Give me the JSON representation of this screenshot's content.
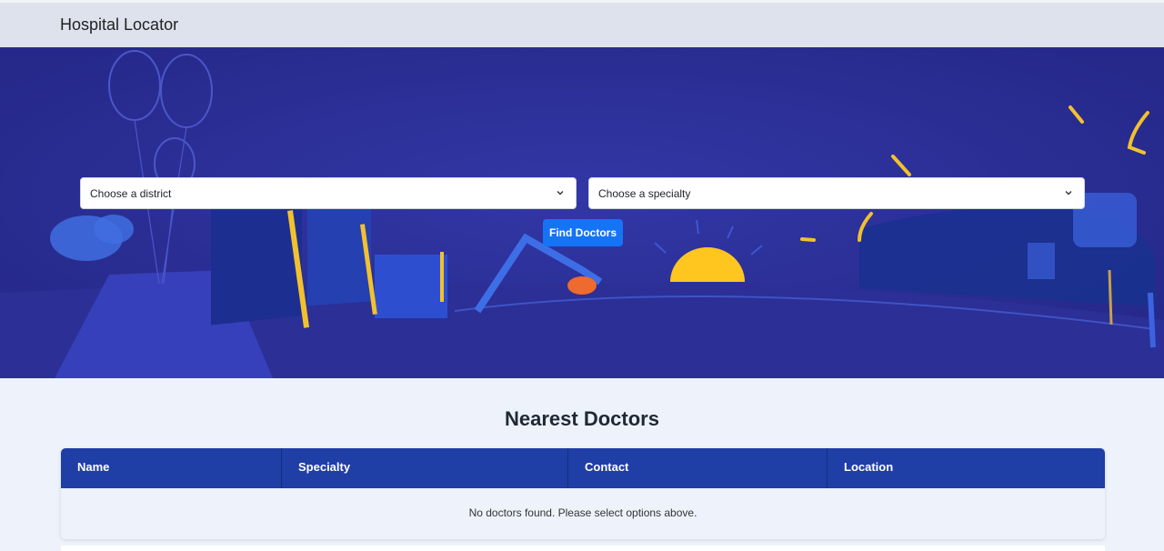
{
  "app": {
    "title": "Hospital Locator"
  },
  "search": {
    "district_placeholder": "Choose a district",
    "specialty_placeholder": "Choose a specialty",
    "submit_label": "Find Doctors"
  },
  "results": {
    "title": "Nearest Doctors",
    "columns": [
      "Name",
      "Specialty",
      "Contact",
      "Location"
    ],
    "empty_message": "No doctors found. Please select options above."
  },
  "colors": {
    "hero_background": "#2a2d92",
    "primary_button": "#1574f6",
    "table_header": "#1f3ea6",
    "page_background": "#eef3fb"
  },
  "icons": {
    "select_chevron": "chevron-down-icon"
  }
}
